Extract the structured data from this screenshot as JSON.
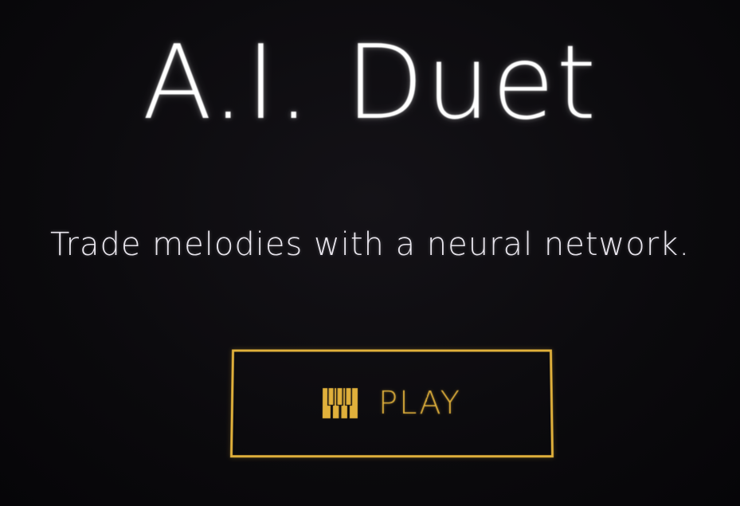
{
  "title": "A.I. Duet",
  "subtitle": "Trade melodies with a neural network.",
  "play_button": {
    "label": "PLAY",
    "icon": "piano-keys-icon"
  },
  "colors": {
    "background": "#0b0a0d",
    "title": "#ffffff",
    "subtitle": "#e9e6ee",
    "accent": "#e0b03b"
  }
}
